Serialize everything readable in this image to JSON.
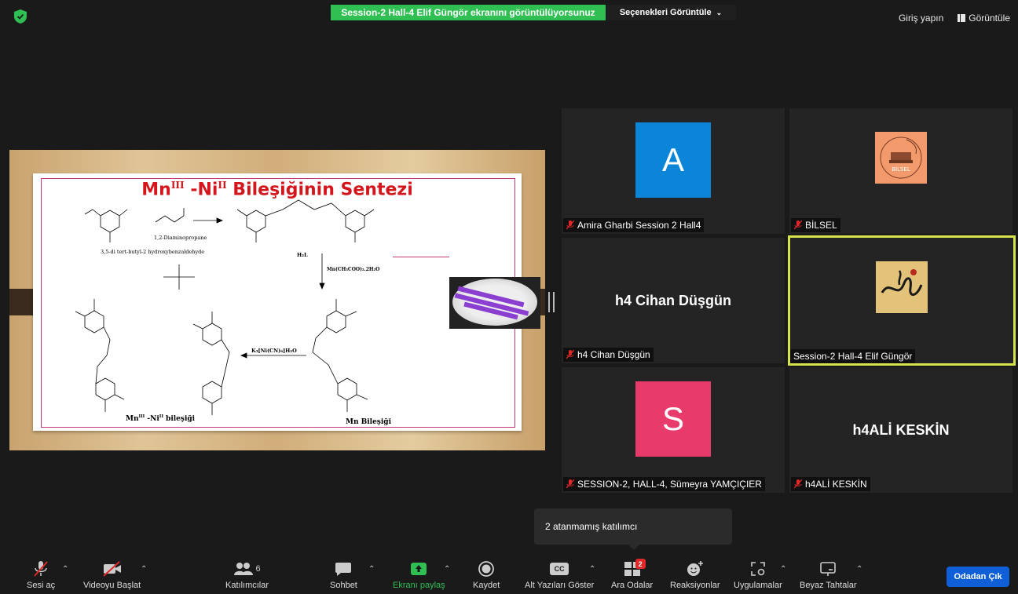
{
  "top": {
    "share_banner": "Session-2 Hall-4 Elif Güngör ekranını görüntülüyorsunuz",
    "view_options": "Seçenekleri Görüntüle",
    "signin": "Giriş yapın",
    "view": "Görüntüle"
  },
  "slide": {
    "title_mn": "Mn",
    "title_mn_sup": "III",
    "title_dash": " -Ni",
    "title_ni_sup": "II",
    "title_rest": " Bileşiğinin Sentezi",
    "label_diamine": "1,2-Diaminopropane",
    "label_aldehyde": "3,5-di tert-butyl-2 hydroxybenzaldehyde",
    "label_h2l": "H₂L",
    "label_mn_reagent": "Mn(CH₃COO)₂.2H₂O",
    "label_k3": "K₃[Ni(CN)₆]H₂O",
    "label_mn_ni": "Mn",
    "label_mn_ni_sup1": "III",
    "label_mn_ni_mid": " -Ni",
    "label_mn_ni_sup2": "II",
    "label_mn_ni_rest": " bileşiği",
    "label_mn_compound": "Mn Bileşiği"
  },
  "participants": [
    {
      "name": "Amira Gharbi Session 2 Hall4",
      "avatar_letter": "A",
      "avatar_color": "#0b85d8",
      "muted": true
    },
    {
      "name": "BİLSEL",
      "avatar_image": "bilsel-logo",
      "muted": true
    },
    {
      "name": "h4 Cihan Düşgün",
      "display_name": "h4 Cihan Düşgün",
      "muted": true
    },
    {
      "name": "Session-2 Hall-4 Elif Güngör",
      "avatar_image": "elif-calligraphy",
      "muted": false,
      "active_speaker": true
    },
    {
      "name": "SESSION-2, HALL-4, Sümeyra YAMÇIÇIER",
      "avatar_letter": "S",
      "avatar_color": "#e83a6b",
      "muted": true
    },
    {
      "name": "h4ALİ KESKİN",
      "display_name": "h4ALİ KESKİN",
      "muted": true
    }
  ],
  "tooltip": "2 atanmamış katılımcı",
  "toolbar": {
    "unmute": "Sesi aç",
    "start_video": "Videoyu Başlat",
    "participants": "Katılımcılar",
    "participants_count": "6",
    "chat": "Sohbet",
    "share_screen": "Ekranı paylaş",
    "record": "Kaydet",
    "captions": "Alt Yazıları Göster",
    "captions_glyph": "CC",
    "breakout": "Ara Odalar",
    "breakout_badge": "2",
    "reactions": "Reaksiyonlar",
    "apps": "Uygulamalar",
    "whiteboard": "Beyaz Tahtalar",
    "leave": "Odadan Çık"
  },
  "colors": {
    "share_green": "#2fbf53",
    "active_outline": "#d7e34b",
    "leave_blue": "#0e5fd8",
    "mute_red": "#e02828"
  }
}
